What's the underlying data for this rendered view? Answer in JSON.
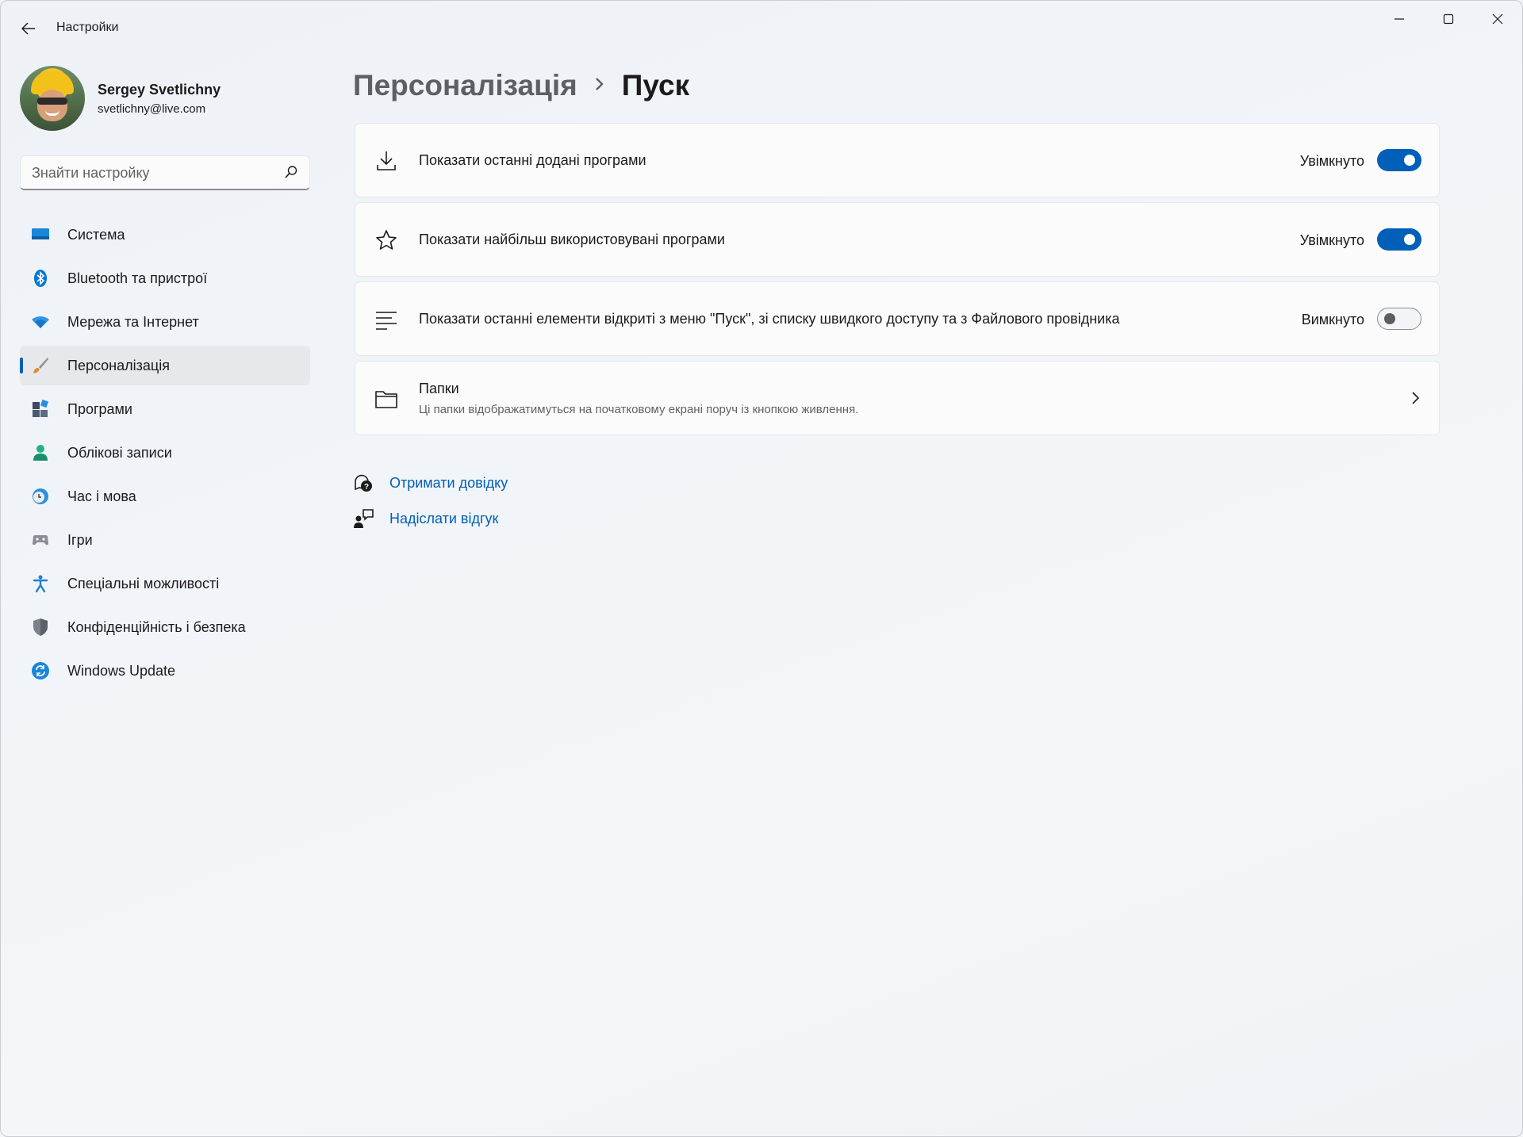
{
  "window": {
    "title": "Настройки",
    "controls": [
      "minimize-icon",
      "maximize-icon",
      "close-icon"
    ]
  },
  "profile": {
    "name": "Sergey Svetlichny",
    "email": "svetlichny@live.com"
  },
  "search": {
    "placeholder": "Знайти настройку"
  },
  "sidebar": {
    "items": [
      {
        "label": "Система",
        "icon": "system-icon",
        "color": "#0a6cc2"
      },
      {
        "label": "Bluetooth та пристрої",
        "icon": "bluetooth-icon",
        "color": "#0078d4"
      },
      {
        "label": "Мережа та Інтернет",
        "icon": "network-wifi-icon",
        "color": "#1f8fe0"
      },
      {
        "label": "Персоналізація",
        "icon": "brush-icon",
        "color": "#e38a2c",
        "active": true
      },
      {
        "label": "Програми",
        "icon": "apps-icon",
        "color": "#4a5a72"
      },
      {
        "label": "Облікові записи",
        "icon": "accounts-icon",
        "color": "#1aa37a"
      },
      {
        "label": "Час і мова",
        "icon": "time-language-icon",
        "color": "#2f8fd8"
      },
      {
        "label": "Ігри",
        "icon": "gaming-icon",
        "color": "#8a8f96"
      },
      {
        "label": "Спеціальні можливості",
        "icon": "accessibility-icon",
        "color": "#1f7fd0"
      },
      {
        "label": "Конфіденційність і безпека",
        "icon": "shield-icon",
        "color": "#6d737a"
      },
      {
        "label": "Windows Update",
        "icon": "windows-update-icon",
        "color": "#0a6cc2"
      }
    ]
  },
  "breadcrumb": {
    "parent": "Персоналізація",
    "current": "Пуск"
  },
  "settings": [
    {
      "title": "Показати останні додані програми",
      "icon": "download-icon",
      "state": "Увімкнуто",
      "on": true
    },
    {
      "title": "Показати найбільш використовувані програми",
      "icon": "star-icon",
      "state": "Увімкнуто",
      "on": true
    },
    {
      "title": "Показати останні елементи відкриті з меню \"Пуск\", зі списку швидкого доступу та з Файлового провідника",
      "icon": "list-icon",
      "state": "Вимкнуто",
      "on": false
    },
    {
      "title": "Папки",
      "subtitle": "Ці папки відображатимуться на початковому екрані поруч із кнопкою живлення.",
      "icon": "folder-icon"
    }
  ],
  "links": {
    "help": "Отримати довідку",
    "feedback": "Надіслати відгук"
  },
  "colors": {
    "accent": "#005fb8",
    "background": "#f1f4f8"
  }
}
